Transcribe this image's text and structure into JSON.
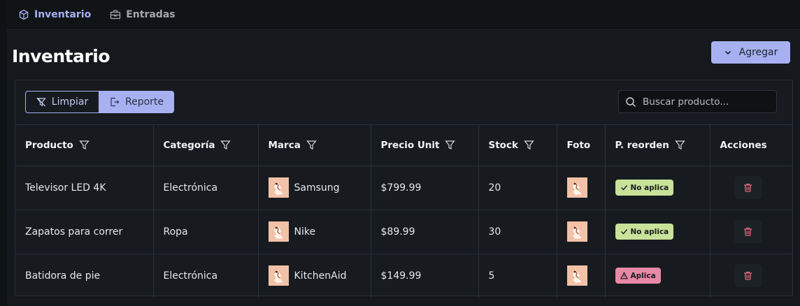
{
  "tabs": [
    {
      "label": "Inventario",
      "icon": "cube-icon"
    },
    {
      "label": "Entradas",
      "icon": "briefcase-icon"
    }
  ],
  "page_title": "Inventario",
  "add_button": {
    "label": "Agregar",
    "icon": "chevron-down-icon"
  },
  "toolbar": {
    "clear_label": "Limpiar",
    "report_label": "Reporte",
    "search_placeholder": "Buscar producto..."
  },
  "columns": [
    "Producto",
    "Categoría",
    "Marca",
    "Precio Unit",
    "Stock",
    "Foto",
    "P. reorden",
    "Acciones"
  ],
  "rows": [
    {
      "producto": "Televisor LED 4K",
      "categoria": "Electrónica",
      "marca": "Samsung",
      "precio": "$799.99",
      "stock": "20",
      "reorden": "No aplica",
      "reorden_status": "ok"
    },
    {
      "producto": "Zapatos para correr",
      "categoria": "Ropa",
      "marca": "Nike",
      "precio": "$89.99",
      "stock": "30",
      "reorden": "No aplica",
      "reorden_status": "ok"
    },
    {
      "producto": "Batidora de pie",
      "categoria": "Electrónica",
      "marca": "KitchenAid",
      "precio": "$149.99",
      "stock": "5",
      "reorden": "Aplica",
      "reorden_status": "warn"
    }
  ],
  "colors": {
    "accent": "#a7b1f1",
    "ok": "#c8e29a",
    "warn": "#e889a6",
    "danger": "#e06a7e"
  }
}
